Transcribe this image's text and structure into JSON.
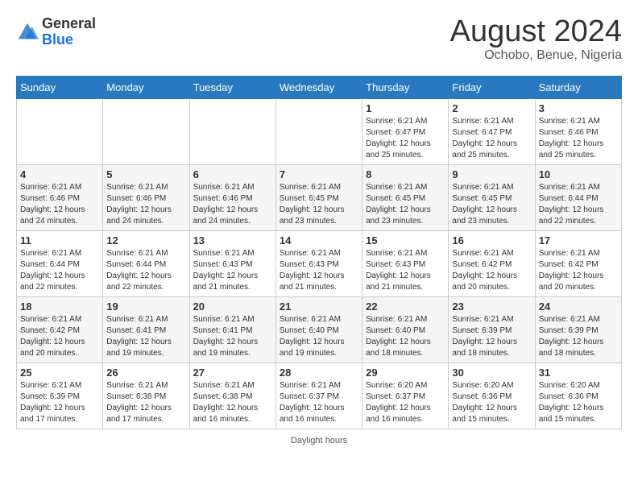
{
  "header": {
    "logo_general": "General",
    "logo_blue": "Blue",
    "month_title": "August 2024",
    "location": "Ochobo, Benue, Nigeria"
  },
  "calendar": {
    "days_of_week": [
      "Sunday",
      "Monday",
      "Tuesday",
      "Wednesday",
      "Thursday",
      "Friday",
      "Saturday"
    ],
    "weeks": [
      [
        {
          "day": "",
          "info": ""
        },
        {
          "day": "",
          "info": ""
        },
        {
          "day": "",
          "info": ""
        },
        {
          "day": "",
          "info": ""
        },
        {
          "day": "1",
          "info": "Sunrise: 6:21 AM\nSunset: 6:47 PM\nDaylight: 12 hours\nand 25 minutes."
        },
        {
          "day": "2",
          "info": "Sunrise: 6:21 AM\nSunset: 6:47 PM\nDaylight: 12 hours\nand 25 minutes."
        },
        {
          "day": "3",
          "info": "Sunrise: 6:21 AM\nSunset: 6:46 PM\nDaylight: 12 hours\nand 25 minutes."
        }
      ],
      [
        {
          "day": "4",
          "info": "Sunrise: 6:21 AM\nSunset: 6:46 PM\nDaylight: 12 hours\nand 24 minutes."
        },
        {
          "day": "5",
          "info": "Sunrise: 6:21 AM\nSunset: 6:46 PM\nDaylight: 12 hours\nand 24 minutes."
        },
        {
          "day": "6",
          "info": "Sunrise: 6:21 AM\nSunset: 6:46 PM\nDaylight: 12 hours\nand 24 minutes."
        },
        {
          "day": "7",
          "info": "Sunrise: 6:21 AM\nSunset: 6:45 PM\nDaylight: 12 hours\nand 23 minutes."
        },
        {
          "day": "8",
          "info": "Sunrise: 6:21 AM\nSunset: 6:45 PM\nDaylight: 12 hours\nand 23 minutes."
        },
        {
          "day": "9",
          "info": "Sunrise: 6:21 AM\nSunset: 6:45 PM\nDaylight: 12 hours\nand 23 minutes."
        },
        {
          "day": "10",
          "info": "Sunrise: 6:21 AM\nSunset: 6:44 PM\nDaylight: 12 hours\nand 22 minutes."
        }
      ],
      [
        {
          "day": "11",
          "info": "Sunrise: 6:21 AM\nSunset: 6:44 PM\nDaylight: 12 hours\nand 22 minutes."
        },
        {
          "day": "12",
          "info": "Sunrise: 6:21 AM\nSunset: 6:44 PM\nDaylight: 12 hours\nand 22 minutes."
        },
        {
          "day": "13",
          "info": "Sunrise: 6:21 AM\nSunset: 6:43 PM\nDaylight: 12 hours\nand 21 minutes."
        },
        {
          "day": "14",
          "info": "Sunrise: 6:21 AM\nSunset: 6:43 PM\nDaylight: 12 hours\nand 21 minutes."
        },
        {
          "day": "15",
          "info": "Sunrise: 6:21 AM\nSunset: 6:43 PM\nDaylight: 12 hours\nand 21 minutes."
        },
        {
          "day": "16",
          "info": "Sunrise: 6:21 AM\nSunset: 6:42 PM\nDaylight: 12 hours\nand 20 minutes."
        },
        {
          "day": "17",
          "info": "Sunrise: 6:21 AM\nSunset: 6:42 PM\nDaylight: 12 hours\nand 20 minutes."
        }
      ],
      [
        {
          "day": "18",
          "info": "Sunrise: 6:21 AM\nSunset: 6:42 PM\nDaylight: 12 hours\nand 20 minutes."
        },
        {
          "day": "19",
          "info": "Sunrise: 6:21 AM\nSunset: 6:41 PM\nDaylight: 12 hours\nand 19 minutes."
        },
        {
          "day": "20",
          "info": "Sunrise: 6:21 AM\nSunset: 6:41 PM\nDaylight: 12 hours\nand 19 minutes."
        },
        {
          "day": "21",
          "info": "Sunrise: 6:21 AM\nSunset: 6:40 PM\nDaylight: 12 hours\nand 19 minutes."
        },
        {
          "day": "22",
          "info": "Sunrise: 6:21 AM\nSunset: 6:40 PM\nDaylight: 12 hours\nand 18 minutes."
        },
        {
          "day": "23",
          "info": "Sunrise: 6:21 AM\nSunset: 6:39 PM\nDaylight: 12 hours\nand 18 minutes."
        },
        {
          "day": "24",
          "info": "Sunrise: 6:21 AM\nSunset: 6:39 PM\nDaylight: 12 hours\nand 18 minutes."
        }
      ],
      [
        {
          "day": "25",
          "info": "Sunrise: 6:21 AM\nSunset: 6:39 PM\nDaylight: 12 hours\nand 17 minutes."
        },
        {
          "day": "26",
          "info": "Sunrise: 6:21 AM\nSunset: 6:38 PM\nDaylight: 12 hours\nand 17 minutes."
        },
        {
          "day": "27",
          "info": "Sunrise: 6:21 AM\nSunset: 6:38 PM\nDaylight: 12 hours\nand 16 minutes."
        },
        {
          "day": "28",
          "info": "Sunrise: 6:21 AM\nSunset: 6:37 PM\nDaylight: 12 hours\nand 16 minutes."
        },
        {
          "day": "29",
          "info": "Sunrise: 6:20 AM\nSunset: 6:37 PM\nDaylight: 12 hours\nand 16 minutes."
        },
        {
          "day": "30",
          "info": "Sunrise: 6:20 AM\nSunset: 6:36 PM\nDaylight: 12 hours\nand 15 minutes."
        },
        {
          "day": "31",
          "info": "Sunrise: 6:20 AM\nSunset: 6:36 PM\nDaylight: 12 hours\nand 15 minutes."
        }
      ]
    ]
  },
  "footer": {
    "text": "Daylight hours"
  }
}
